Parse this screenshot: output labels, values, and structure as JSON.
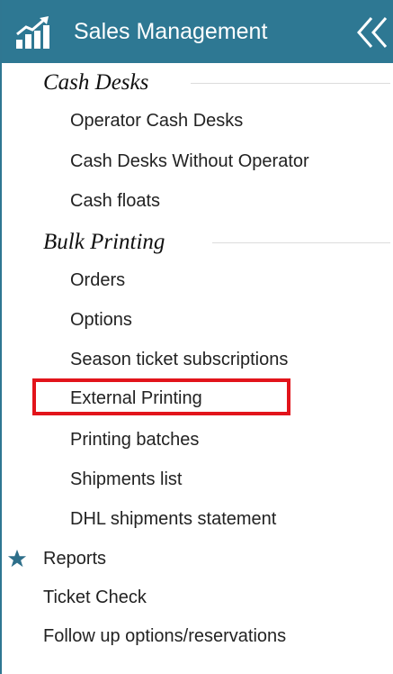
{
  "header": {
    "title": "Sales Management",
    "logo_icon": "bar-chart-growth-icon",
    "collapse_icon": "double-chevron-left-icon",
    "bg_color": "#2e7893"
  },
  "sections": [
    {
      "title": "Cash Desks",
      "items": [
        "Operator Cash Desks",
        "Cash Desks Without Operator",
        "Cash floats"
      ]
    },
    {
      "title": "Bulk Printing",
      "items": [
        "Orders",
        "Options",
        "Season ticket subscriptions",
        "External Printing",
        "Printing batches",
        "Shipments list",
        "DHL shipments statement"
      ]
    }
  ],
  "top_items": [
    {
      "label": "Reports",
      "icon": "star-icon"
    },
    {
      "label": "Ticket Check"
    },
    {
      "label": "Follow up options/reservations"
    }
  ],
  "highlight": {
    "item": "External Printing",
    "color": "#e2141b"
  }
}
